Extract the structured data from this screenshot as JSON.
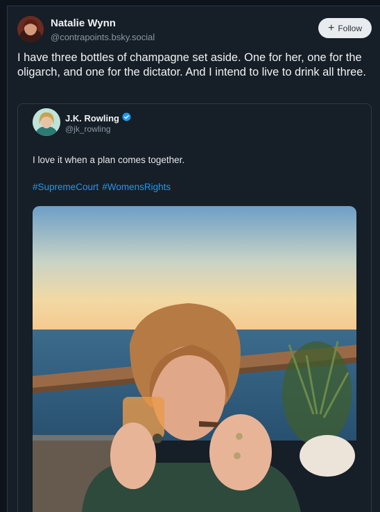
{
  "post": {
    "author_name": "Natalie Wynn",
    "author_handle": "@contrapoints.bsky.social",
    "follow_label": "Follow",
    "text": "I have three bottles of champagne set aside. One for her, one for the oligarch, and one for the dictator. And I intend to live to drink all three."
  },
  "quote": {
    "author_name": "J.K. Rowling",
    "author_handle": "@jk_rowling",
    "verified": true,
    "text": "I love it when a plan comes together.",
    "hashtags": [
      "#SupremeCourt",
      "#WomensRights"
    ],
    "verified_color": "#1d9bf0",
    "link_color": "#1d9bf0"
  },
  "icons": {
    "follow": "plus-icon",
    "verified": "verified-badge-icon"
  }
}
